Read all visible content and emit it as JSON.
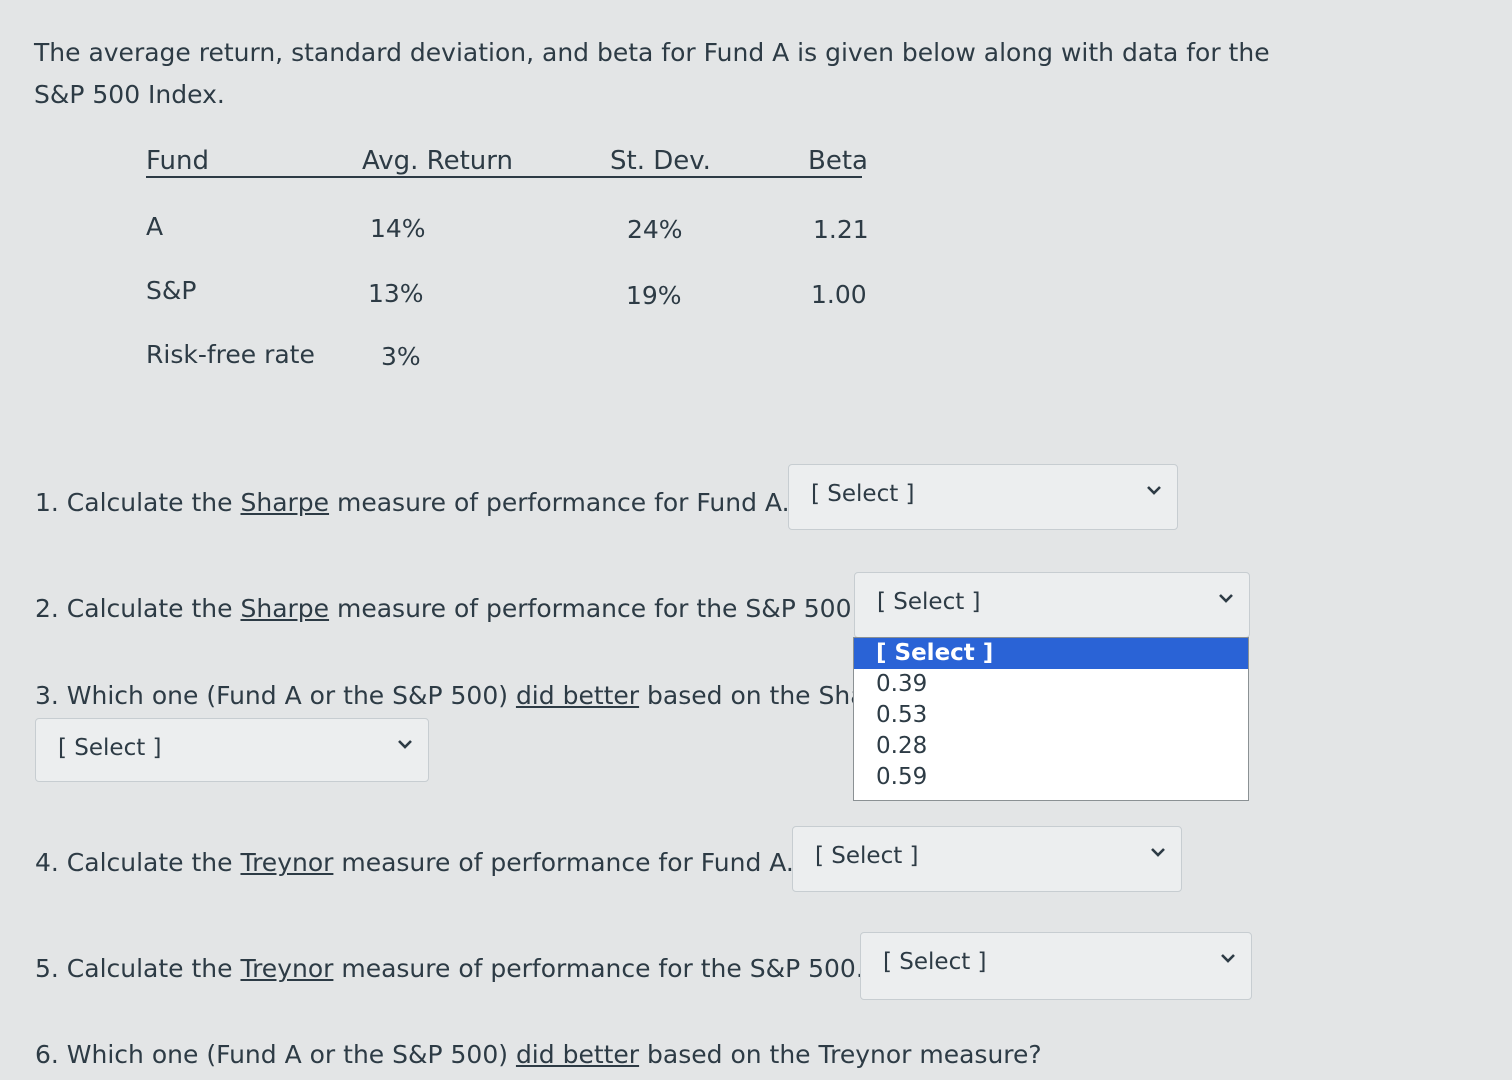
{
  "intro": "The average return, standard deviation, and beta for Fund A is given below along with data for the S&P 500 Index.",
  "table": {
    "headers": [
      "Fund",
      "Avg. Return",
      "St. Dev.",
      "Beta"
    ],
    "rows": [
      [
        "A",
        "14%",
        "24%",
        "1.21"
      ],
      [
        "S&P",
        "13%",
        "19%",
        "1.00"
      ],
      [
        "Risk-free rate",
        "3%",
        "",
        ""
      ]
    ]
  },
  "questions": [
    {
      "pre": "1. Calculate the ",
      "link": "Sharpe",
      "post": " measure of performance for Fund A."
    },
    {
      "pre": "2. Calculate the ",
      "link": "Sharpe",
      "post": " measure of performance for the S&P 500."
    },
    {
      "pre": "3. Which one (Fund A or the S&P 500) ",
      "link": "did better",
      "post": " based on the Sha"
    },
    {
      "pre": "4. Calculate the ",
      "link": "Treynor",
      "post": " measure of performance for Fund A."
    },
    {
      "pre": "5. Calculate the ",
      "link": "Treynor",
      "post": " measure of performance for the S&P 500."
    },
    {
      "pre": "6. Which one (Fund A or the S&P 500) ",
      "link": "did better",
      "post": " based on the Treynor measure?"
    }
  ],
  "selects": [
    "[ Select ]",
    "[ Select ]",
    "[ Select ]",
    "[ Select ]",
    "[ Select ]"
  ],
  "dropdown": {
    "options": [
      "[ Select ]",
      "0.39",
      "0.53",
      "0.28",
      "0.59"
    ],
    "highlighted_index": 0,
    "highlight_color": "#2a63d6"
  }
}
